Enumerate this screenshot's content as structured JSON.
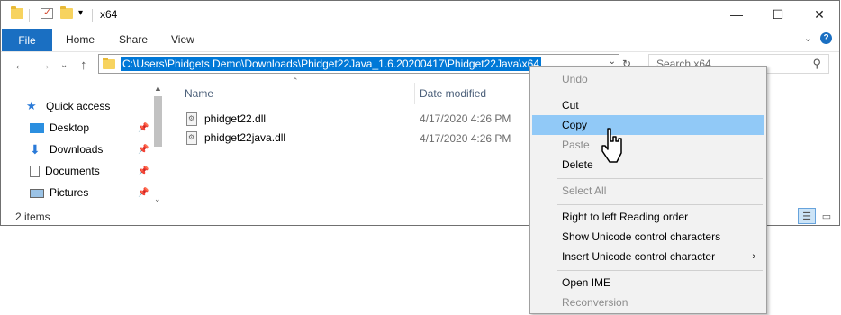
{
  "window": {
    "title": "x64",
    "minimize_glyph": "—",
    "maximize_glyph": "☐",
    "close_glyph": "✕"
  },
  "ribbon": {
    "tabs": [
      "File",
      "Home",
      "Share",
      "View"
    ],
    "expand_glyph": "⌄",
    "help_glyph": "?"
  },
  "nav": {
    "back_glyph": "←",
    "forward_glyph": "→",
    "recent_glyph": "⌄",
    "up_glyph": "↑",
    "address": "C:\\Users\\Phidgets Demo\\Downloads\\Phidget22Java_1.6.20200417\\Phidget22Java\\x64",
    "search_placeholder": "Search x64"
  },
  "sidebar": {
    "items": [
      {
        "label": "Quick access",
        "icon": "star-icon"
      },
      {
        "label": "Desktop",
        "icon": "desktop-icon",
        "pinned": true
      },
      {
        "label": "Downloads",
        "icon": "download-icon",
        "pinned": true
      },
      {
        "label": "Documents",
        "icon": "documents-icon",
        "pinned": true
      },
      {
        "label": "Pictures",
        "icon": "pictures-icon",
        "pinned": true
      }
    ]
  },
  "file_list": {
    "columns": [
      "Name",
      "Date modified"
    ],
    "files": [
      {
        "name": "phidget22.dll",
        "date": "4/17/2020 4:26 PM"
      },
      {
        "name": "phidget22java.dll",
        "date": "4/17/2020 4:26 PM"
      }
    ]
  },
  "status": {
    "count": "2 items"
  },
  "context_menu": {
    "items": [
      {
        "label": "Undo",
        "disabled": true
      },
      {
        "label": "Cut",
        "disabled": false
      },
      {
        "label": "Copy",
        "disabled": false,
        "highlighted": true
      },
      {
        "label": "Paste",
        "disabled": true
      },
      {
        "label": "Delete",
        "disabled": false
      },
      {
        "label": "Select All",
        "disabled": true
      },
      {
        "label": "Right to left Reading order",
        "disabled": false
      },
      {
        "label": "Show Unicode control characters",
        "disabled": false
      },
      {
        "label": "Insert Unicode control character",
        "disabled": false,
        "submenu": true
      },
      {
        "label": "Open IME",
        "disabled": false
      },
      {
        "label": "Reconversion",
        "disabled": true
      }
    ]
  },
  "colors": {
    "accent": "#1a6fc2",
    "selection": "#0078d7",
    "menu_highlight": "#91c9f7"
  }
}
